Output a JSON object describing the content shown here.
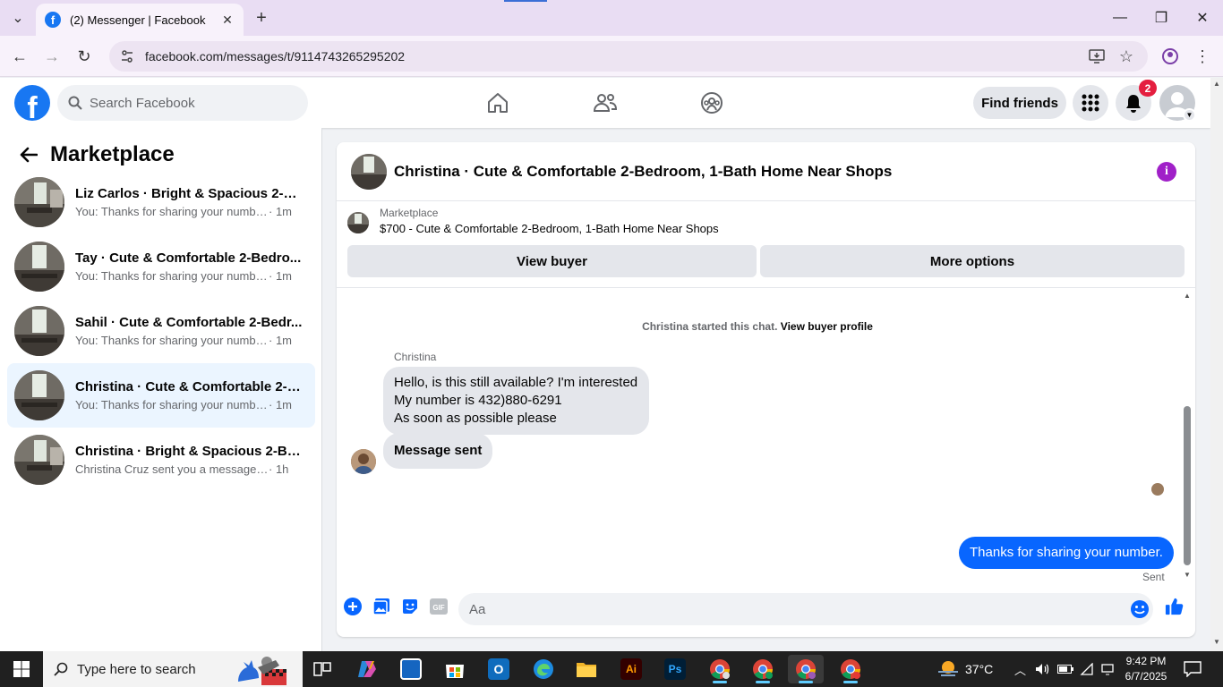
{
  "browser": {
    "tab_title": "(2) Messenger | Facebook",
    "url": "facebook.com/messages/t/9114743265295202"
  },
  "fb": {
    "search_placeholder": "Search Facebook",
    "find_friends": "Find friends",
    "notification_count": "2",
    "brand_color": "#1877f2"
  },
  "sidebar": {
    "title": "Marketplace",
    "conversations": [
      {
        "name": "Liz Carlos · Bright & Spacious 2-Be...",
        "snippet": "You: Thanks for sharing your number.",
        "time": "· 1m",
        "active": false
      },
      {
        "name": "Tay · Cute & Comfortable 2-Bedro...",
        "snippet": "You: Thanks for sharing your number.",
        "time": "· 1m",
        "active": false
      },
      {
        "name": "Sahil · Cute & Comfortable 2-Bedr...",
        "snippet": "You: Thanks for sharing your number.",
        "time": "· 1m",
        "active": false
      },
      {
        "name": "Christina · Cute & Comfortable 2-B...",
        "snippet": "You: Thanks for sharing your number.",
        "time": "· 1m",
        "active": true
      },
      {
        "name": "Christina · Bright & Spacious 2-Be...",
        "snippet": "Christina Cruz sent you a message ab...",
        "time": "· 1h",
        "active": false
      }
    ]
  },
  "chat": {
    "title": "Christina · Cute & Comfortable 2-Bedroom, 1-Bath Home Near Shops",
    "marketplace_label": "Marketplace",
    "listing": "$700 - Cute & Comfortable 2-Bedroom, 1-Bath Home Near Shops",
    "view_buyer": "View buyer",
    "more_options": "More options",
    "system_text": "Christina started this chat.",
    "system_link": "View buyer profile",
    "sender_name": "Christina",
    "incoming_lines": [
      "Hello, is this still available? I'm interested",
      "My number is 432)880-6291",
      "As soon as possible please"
    ],
    "incoming_2": "Message sent",
    "outgoing": "Thanks for sharing your number.",
    "status": "Sent",
    "input_placeholder": "Aa",
    "accent_color": "#0866ff"
  },
  "taskbar": {
    "search_placeholder": "Type here to search",
    "temperature": "37°C",
    "time": "9:42 PM",
    "date": "6/7/2025"
  }
}
